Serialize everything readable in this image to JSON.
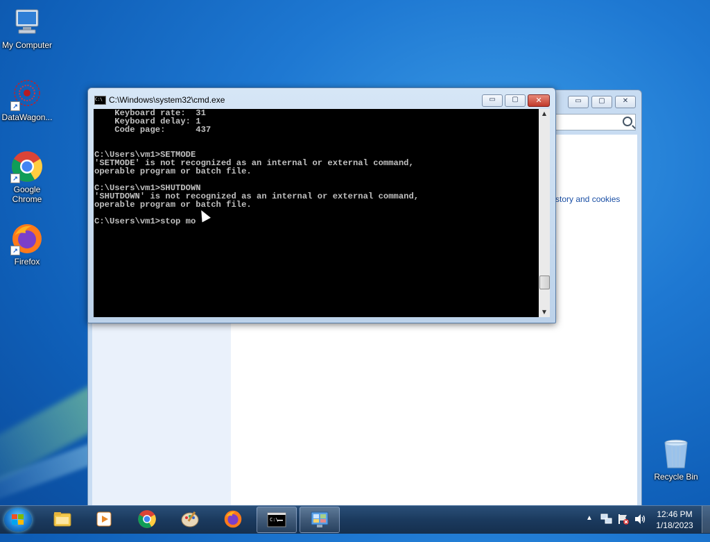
{
  "desktop": {
    "icons": [
      {
        "label": "My Computer",
        "icon": "computer-icon"
      },
      {
        "label": "DataWagon...",
        "icon": "datawagon-icon"
      },
      {
        "label": "Google Chrome",
        "icon": "chrome-icon"
      },
      {
        "label": "Firefox",
        "icon": "firefox-icon"
      },
      {
        "label": "Recycle Bin",
        "icon": "recycle-bin-icon"
      }
    ]
  },
  "background_window": {
    "link_text": "story and cookies",
    "buttons": {
      "minimize": "▭",
      "maximize": "▢",
      "close": "✕"
    }
  },
  "cmd_window": {
    "title": "C:\\Windows\\system32\\cmd.exe",
    "icon_text": "C:\\",
    "buttons": {
      "minimize": "▭",
      "maximize": "▢",
      "close": "✕"
    },
    "console_lines": [
      "    Keyboard rate:  31",
      "    Keyboard delay: 1",
      "    Code page:      437",
      "",
      "",
      "C:\\Users\\vm1>SETMODE",
      "'SETMODE' is not recognized as an internal or external command,",
      "operable program or batch file.",
      "",
      "C:\\Users\\vm1>SHUTDOWN",
      "'SHUTDOWN' is not recognized as an internal or external command,",
      "operable program or batch file.",
      "",
      "C:\\Users\\vm1>stop mo"
    ]
  },
  "taskbar": {
    "items": [
      {
        "name": "file-explorer",
        "active": false
      },
      {
        "name": "media-player",
        "active": false
      },
      {
        "name": "chrome",
        "active": false
      },
      {
        "name": "paint",
        "active": false
      },
      {
        "name": "firefox",
        "active": false
      },
      {
        "name": "cmd",
        "active": true
      },
      {
        "name": "control-panel",
        "active": true
      }
    ],
    "clock": {
      "time": "12:46 PM",
      "date": "1/18/2023"
    }
  },
  "colors": {
    "console_bg": "#000000",
    "console_fg": "#c0c0c0",
    "taskbar": "#1b3a5e",
    "close_button": "#c0392b"
  }
}
